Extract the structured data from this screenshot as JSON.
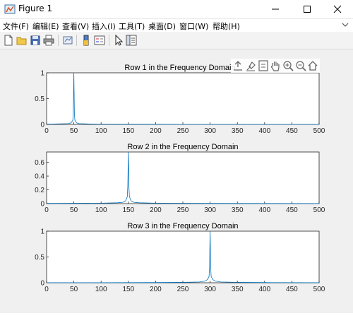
{
  "window": {
    "title": "Figure 1",
    "icon": "matlab-figure-icon",
    "controls": [
      "minimize-icon",
      "maximize-icon",
      "close-icon"
    ]
  },
  "menu": [
    "文件(F)",
    "编辑(E)",
    "查看(V)",
    "插入(I)",
    "工具(T)",
    "桌面(D)",
    "窗口(W)",
    "帮助(H)"
  ],
  "toolbar": [
    "new-figure-icon",
    "open-file-icon",
    "save-icon",
    "print-icon",
    "link-plot-icon",
    "insert-colorbar-icon",
    "insert-legend-icon",
    "edit-plot-icon",
    "property-inspector-icon"
  ],
  "axes_toolbar": [
    "export-icon",
    "brush-icon",
    "datatip-icon",
    "pan-hand-icon",
    "zoom-in-icon",
    "zoom-out-icon",
    "home-restore-icon"
  ],
  "colors": {
    "line": "#0072bd",
    "figure_bg": "#f0f0f0"
  },
  "chart_data": [
    {
      "type": "line",
      "title": "Row 1 in the Frequency Domain",
      "xlim": [
        0,
        500
      ],
      "ylim": [
        0,
        1
      ],
      "xticks": [
        "0",
        "50",
        "100",
        "150",
        "200",
        "250",
        "300",
        "350",
        "400",
        "450",
        "500"
      ],
      "yticks": [
        "0",
        "0.5",
        "1"
      ],
      "peak": {
        "x": 50,
        "y": 1.0
      },
      "series": [
        {
          "x": [
            0,
            40,
            45,
            48,
            49,
            50,
            51,
            52,
            55,
            60,
            80,
            100,
            200,
            300,
            400,
            500
          ],
          "y": [
            0.005,
            0.015,
            0.03,
            0.08,
            0.2,
            1.0,
            0.2,
            0.08,
            0.03,
            0.015,
            0.008,
            0.005,
            0.003,
            0.002,
            0.002,
            0.001
          ]
        }
      ]
    },
    {
      "type": "line",
      "title": "Row 2 in the Frequency Domain",
      "xlim": [
        0,
        500
      ],
      "ylim": [
        0,
        0.75
      ],
      "xticks": [
        "0",
        "50",
        "100",
        "150",
        "200",
        "250",
        "300",
        "350",
        "400",
        "450",
        "500"
      ],
      "yticks": [
        "0",
        "0.2",
        "0.4",
        "0.6"
      ],
      "peak": {
        "x": 150,
        "y": 0.75
      },
      "series": [
        {
          "x": [
            0,
            100,
            130,
            140,
            145,
            148,
            149,
            150,
            151,
            152,
            155,
            160,
            170,
            200,
            300,
            400,
            500
          ],
          "y": [
            0.003,
            0.006,
            0.012,
            0.02,
            0.04,
            0.1,
            0.25,
            0.75,
            0.25,
            0.1,
            0.04,
            0.02,
            0.012,
            0.006,
            0.003,
            0.002,
            0.001
          ]
        }
      ]
    },
    {
      "type": "line",
      "title": "Row 3 in the Frequency Domain",
      "xlim": [
        0,
        500
      ],
      "ylim": [
        0,
        1
      ],
      "xticks": [
        "0",
        "50",
        "100",
        "150",
        "200",
        "250",
        "300",
        "350",
        "400",
        "450",
        "500"
      ],
      "yticks": [
        "0",
        "0.5",
        "1"
      ],
      "peak": {
        "x": 300,
        "y": 1.0
      },
      "series": [
        {
          "x": [
            0,
            100,
            200,
            250,
            280,
            290,
            295,
            298,
            299,
            300,
            301,
            302,
            305,
            310,
            320,
            350,
            400,
            500
          ],
          "y": [
            0.001,
            0.002,
            0.004,
            0.008,
            0.015,
            0.03,
            0.06,
            0.12,
            0.3,
            1.0,
            0.3,
            0.12,
            0.06,
            0.03,
            0.015,
            0.008,
            0.004,
            0.002
          ]
        }
      ]
    }
  ]
}
